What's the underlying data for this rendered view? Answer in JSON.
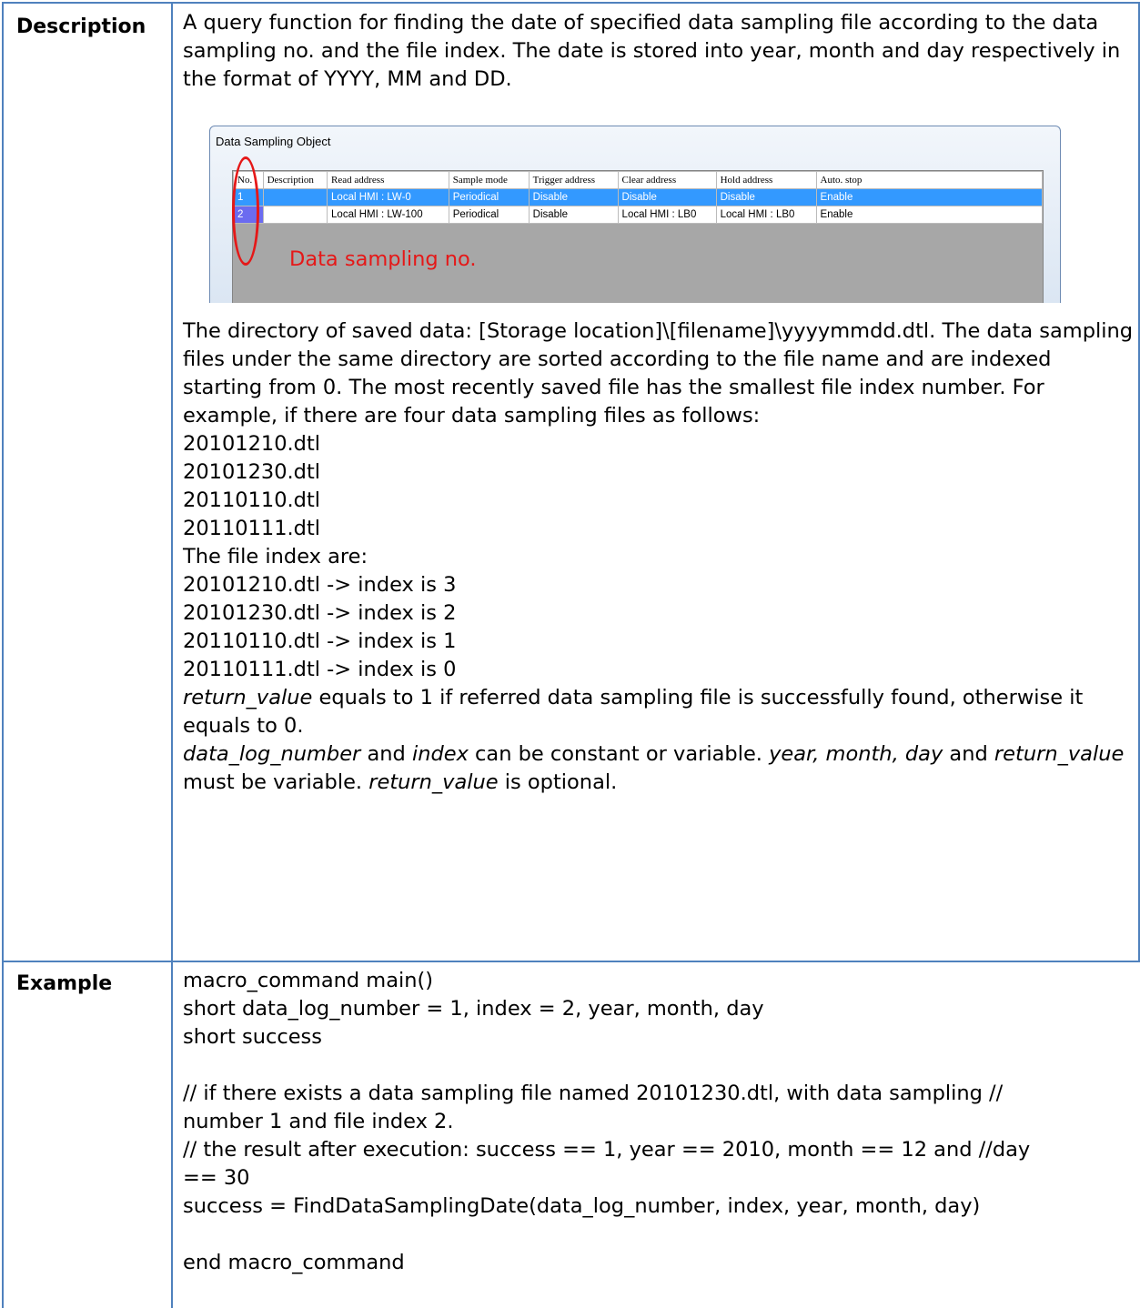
{
  "labels": {
    "description": "Description",
    "example": "Example"
  },
  "description": {
    "intro": "A query function for finding the date of specified data sampling file according to the data sampling no. and the file index. The date is stored into year, month and day respectively in the format of YYYY, MM and DD.",
    "dialog": {
      "title": "Data Sampling Object",
      "headers": [
        "No.",
        "Description",
        "Read address",
        "Sample mode",
        "Trigger address",
        "Clear address",
        "Hold address",
        "Auto. stop"
      ],
      "rows": [
        [
          "1",
          "",
          "Local HMI : LW-0",
          "Periodical",
          "Disable",
          "Disable",
          "Disable",
          "Enable"
        ],
        [
          "2",
          "",
          "Local HMI : LW-100",
          "Periodical",
          "Disable",
          "Local HMI : LB0",
          "Local HMI : LB0",
          "Enable"
        ]
      ],
      "annotation": "Data sampling no."
    },
    "para1": "The directory of saved data: [Storage location]\\[filename]\\yyyymmdd.dtl. The data sampling files under the same directory are sorted according to the file name and are indexed starting from 0. The most recently saved file has the smallest file index number. For example, if there are four data sampling files as follows:",
    "files": [
      "20101210.dtl",
      "20101230.dtl",
      "20110110.dtl",
      "20110111.dtl"
    ],
    "index_heading": "The file index are:",
    "indexes": [
      "20101210.dtl -> index is 3",
      "20101230.dtl -> index is 2",
      "20110110.dtl -> index is 1",
      "20110111.dtl -> index is 0"
    ],
    "rv": {
      "name": "return_value",
      "text": " equals to 1 if referred data sampling file is successfully found, otherwise it equals to 0."
    },
    "note": {
      "a": "data_log_number",
      "b": " and ",
      "c": "index",
      "d": " can be constant or variable. ",
      "e": "year, month, day",
      "f": " and ",
      "g": "return_value",
      "h": " must be variable. ",
      "i": "return_value",
      "j": " is optional."
    }
  },
  "example": {
    "l1": "macro_command main()",
    "l2": "short data_log_number = 1, index = 2, year, month, day",
    "l3": "short success",
    "l4": "// if there exists a data sampling file named 20101230.dtl, with data sampling //",
    "l5": "number 1 and file index 2.",
    "l6": "// the result after execution: success == 1, year == 2010, month == 12 and //day",
    "l7": "== 30",
    "l8": "success = FindDataSamplingDate(data_log_number, index, year, month, day)",
    "l9": "end macro_command"
  }
}
